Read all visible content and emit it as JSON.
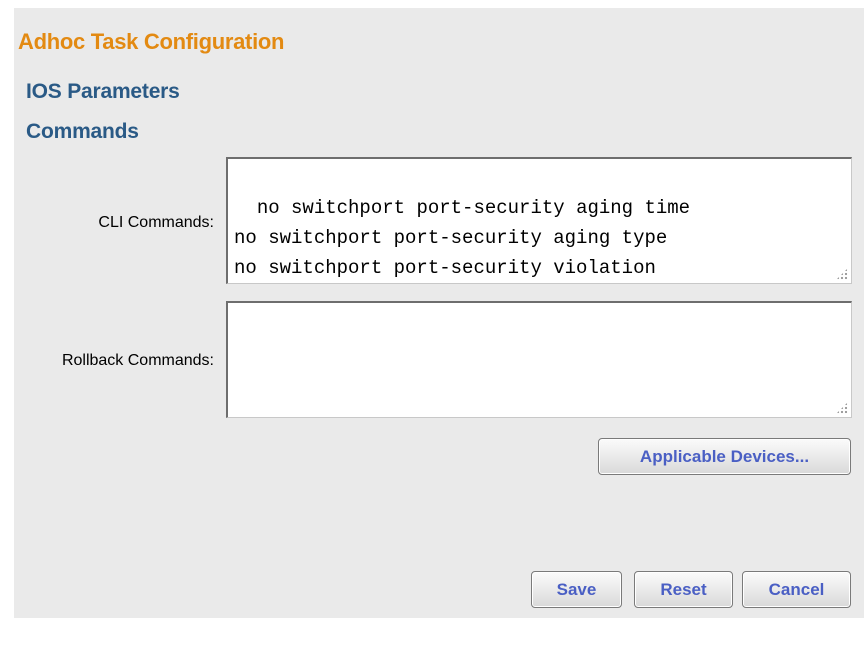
{
  "page": {
    "title": "Adhoc Task Configuration"
  },
  "sections": {
    "ios_parameters": "IOS Parameters",
    "commands": "Commands"
  },
  "form": {
    "cli_label": "CLI Commands:",
    "cli_value": "no switchport port-security aging time\nno switchport port-security aging type\nno switchport port-security violation",
    "rollback_label": "Rollback Commands:",
    "rollback_value": ""
  },
  "buttons": {
    "applicable_devices": "Applicable Devices...",
    "save": "Save",
    "reset": "Reset",
    "cancel": "Cancel"
  },
  "colors": {
    "title": "#e38a12",
    "section": "#2a5a86",
    "button_text": "#4a5fc4",
    "panel_bg": "#eaeaea"
  }
}
